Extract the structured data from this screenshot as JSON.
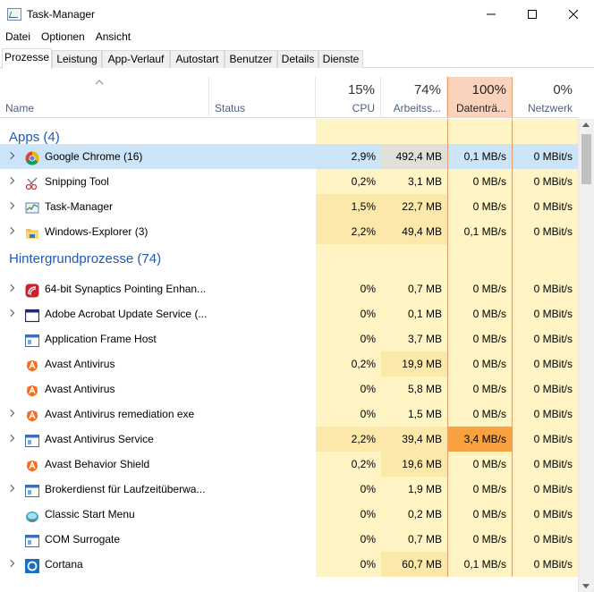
{
  "window": {
    "title": "Task-Manager",
    "minimize": "—",
    "maximize": "☐",
    "close": "✕"
  },
  "menu": [
    "Datei",
    "Optionen",
    "Ansicht"
  ],
  "tabs": [
    "Prozesse",
    "Leistung",
    "App-Verlauf",
    "Autostart",
    "Benutzer",
    "Details",
    "Dienste"
  ],
  "active_tab": "Prozesse",
  "columns": {
    "name": "Name",
    "status": "Status",
    "cpu": {
      "pct": "15%",
      "label": "CPU"
    },
    "mem": {
      "pct": "74%",
      "label": "Arbeitss..."
    },
    "disk": {
      "pct": "100%",
      "label": "Datenträ..."
    },
    "net": {
      "pct": "0%",
      "label": "Netzwerk"
    }
  },
  "groups": {
    "apps": "Apps (4)",
    "background": "Hintergrundprozesse (74)"
  },
  "apps": [
    {
      "name": "Google Chrome (16)",
      "icon": "chrome-icon",
      "cpu": "2,9%",
      "mem": "492,4 MB",
      "disk": "0,1 MB/s",
      "net": "0 MBit/s",
      "expand": true,
      "selected": true
    },
    {
      "name": "Snipping Tool",
      "icon": "snipping-tool-icon",
      "cpu": "0,2%",
      "mem": "3,1 MB",
      "disk": "0 MB/s",
      "net": "0 MBit/s",
      "expand": true
    },
    {
      "name": "Task-Manager",
      "icon": "task-manager-icon",
      "cpu": "1,5%",
      "mem": "22,7 MB",
      "disk": "0 MB/s",
      "net": "0 MBit/s",
      "expand": true
    },
    {
      "name": "Windows-Explorer (3)",
      "icon": "folder-icon",
      "cpu": "2,2%",
      "mem": "49,4 MB",
      "disk": "0,1 MB/s",
      "net": "0 MBit/s",
      "expand": true
    }
  ],
  "background": [
    {
      "name": "64-bit Synaptics Pointing Enhan...",
      "icon": "synaptics-icon",
      "cpu": "0%",
      "mem": "0,7 MB",
      "disk": "0 MB/s",
      "net": "0 MBit/s",
      "expand": true
    },
    {
      "name": "Adobe Acrobat Update Service (...",
      "icon": "window-icon",
      "cpu": "0%",
      "mem": "0,1 MB",
      "disk": "0 MB/s",
      "net": "0 MBit/s",
      "expand": true
    },
    {
      "name": "Application Frame Host",
      "icon": "app-window-icon",
      "cpu": "0%",
      "mem": "3,7 MB",
      "disk": "0 MB/s",
      "net": "0 MBit/s",
      "expand": false
    },
    {
      "name": "Avast Antivirus",
      "icon": "avast-icon",
      "cpu": "0,2%",
      "mem": "19,9 MB",
      "disk": "0 MB/s",
      "net": "0 MBit/s",
      "expand": false
    },
    {
      "name": "Avast Antivirus",
      "icon": "avast-icon",
      "cpu": "0%",
      "mem": "5,8 MB",
      "disk": "0 MB/s",
      "net": "0 MBit/s",
      "expand": false
    },
    {
      "name": "Avast Antivirus  remediation exe",
      "icon": "avast-icon",
      "cpu": "0%",
      "mem": "1,5 MB",
      "disk": "0 MB/s",
      "net": "0 MBit/s",
      "expand": true
    },
    {
      "name": "Avast Antivirus  Service",
      "icon": "app-window-icon",
      "cpu": "2,2%",
      "mem": "39,4 MB",
      "disk": "3,4 MB/s",
      "net": "0 MBit/s",
      "expand": true,
      "disk_hot": true
    },
    {
      "name": "Avast Behavior Shield",
      "icon": "avast-icon",
      "cpu": "0,2%",
      "mem": "19,6 MB",
      "disk": "0 MB/s",
      "net": "0 MBit/s",
      "expand": false
    },
    {
      "name": "Brokerdienst für Laufzeitüberwa...",
      "icon": "app-window-icon",
      "cpu": "0%",
      "mem": "1,9 MB",
      "disk": "0 MB/s",
      "net": "0 MBit/s",
      "expand": true
    },
    {
      "name": "Classic Start Menu",
      "icon": "shell-icon",
      "cpu": "0%",
      "mem": "0,2 MB",
      "disk": "0 MB/s",
      "net": "0 MBit/s",
      "expand": false
    },
    {
      "name": "COM Surrogate",
      "icon": "app-window-icon",
      "cpu": "0%",
      "mem": "0,7 MB",
      "disk": "0 MB/s",
      "net": "0 MBit/s",
      "expand": false
    },
    {
      "name": "Cortana",
      "icon": "cortana-icon",
      "cpu": "0%",
      "mem": "60,7 MB",
      "disk": "0,1 MB/s",
      "net": "0 MBit/s",
      "expand": true
    }
  ],
  "colors": {
    "accent_blue": "#1e5ab4",
    "heat_light": "#fff4c4",
    "heat_mid": "#fce9a9",
    "heat_strong": "#f9dd8f",
    "heat_hot": "#f7a23f",
    "active_column": "#fbd3bc",
    "selection": "#cce4f7"
  }
}
